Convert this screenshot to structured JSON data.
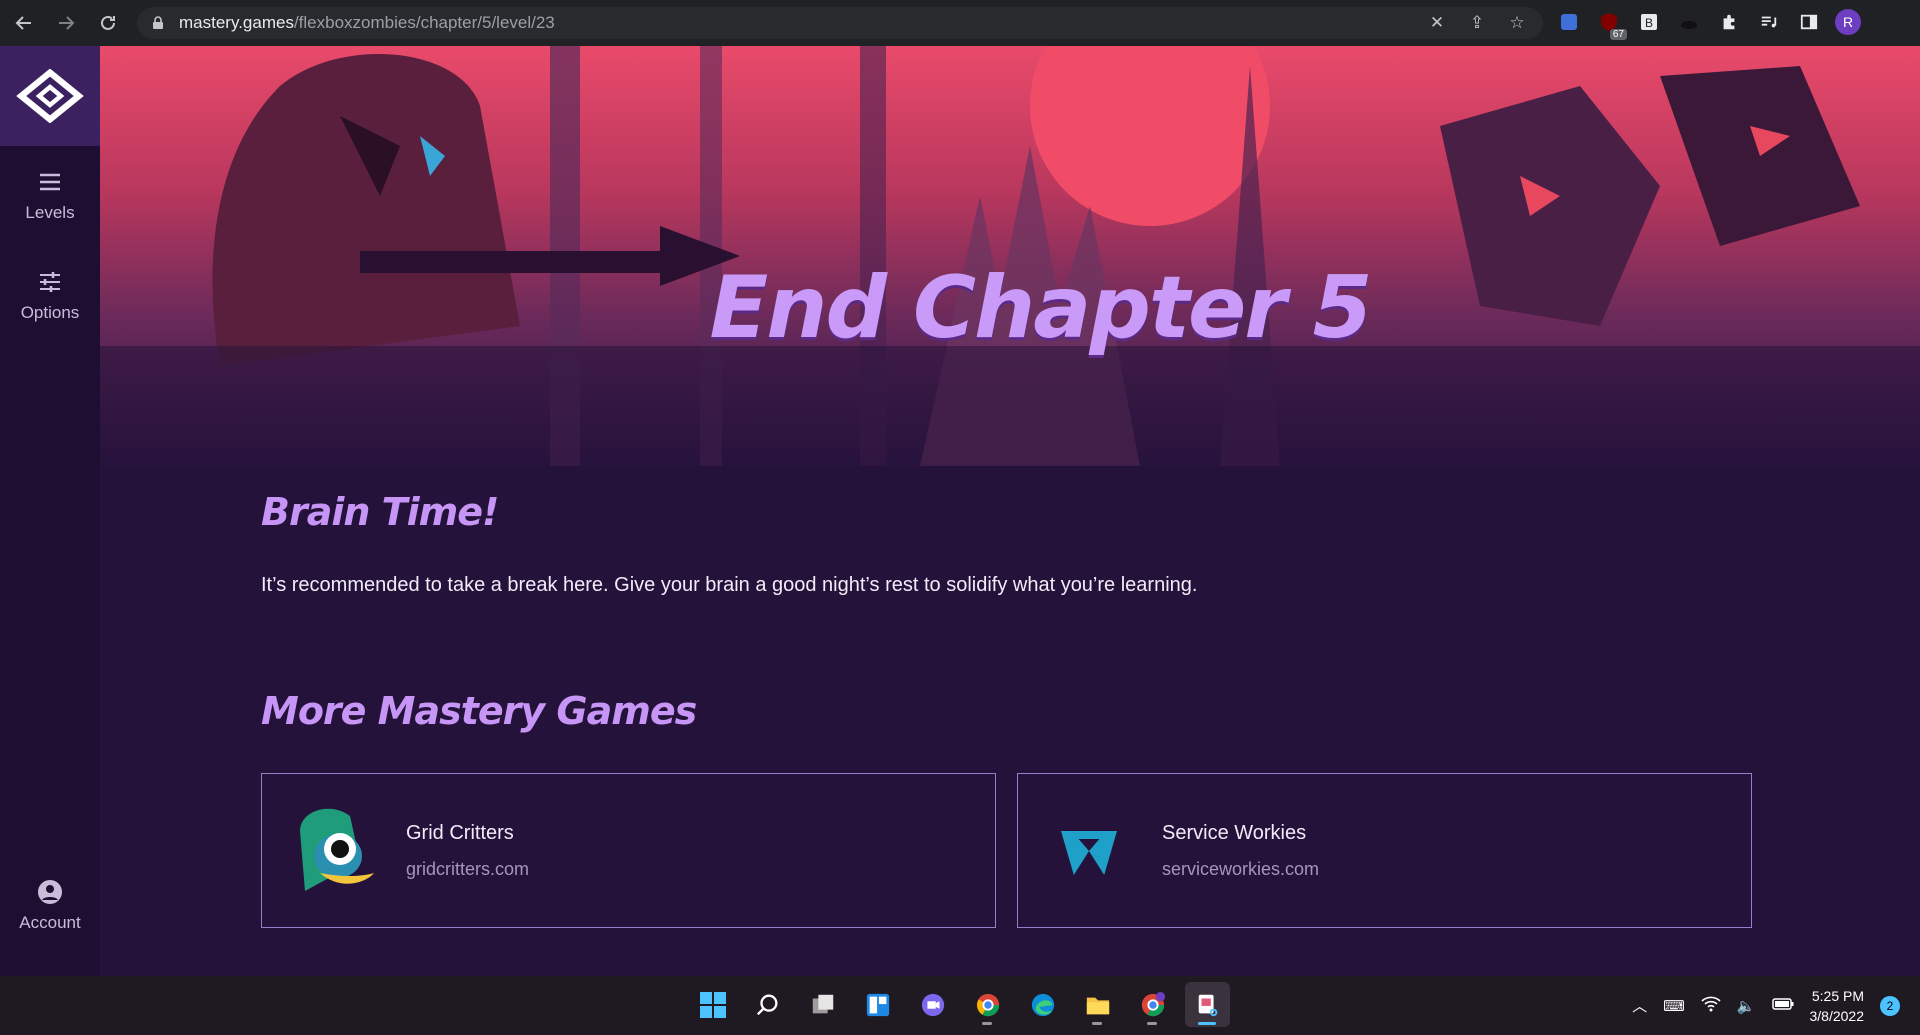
{
  "browser": {
    "url_domain": "mastery.games",
    "url_path": "/flexboxzombies/chapter/5/level/23",
    "extension_badge": "67",
    "profile_initial": "R"
  },
  "sidebar": {
    "items": [
      {
        "label": "Levels",
        "icon": "hamburger-icon"
      },
      {
        "label": "Options",
        "icon": "sliders-icon"
      }
    ],
    "account_label": "Account"
  },
  "hero": {
    "title": "End Chapter 5"
  },
  "main": {
    "brain_heading": "Brain Time!",
    "brain_text": "It’s recommended to take a break here. Give your brain a good night’s rest to solidify what you’re learning.",
    "more_heading": "More Mastery Games",
    "games": [
      {
        "title": "Grid Critters",
        "url": "gridcritters.com",
        "icon": "grid-critters-icon"
      },
      {
        "title": "Service Workies",
        "url": "serviceworkies.com",
        "icon": "service-workies-icon"
      }
    ]
  },
  "taskbar": {
    "time": "5:25 PM",
    "date": "3/8/2022",
    "notifications": "2",
    "colors": {
      "accent": "#4cc2ff"
    }
  },
  "colors": {
    "page_bg": "#24123a",
    "heading": "#c695f5",
    "card_border": "#9b7cc7"
  }
}
